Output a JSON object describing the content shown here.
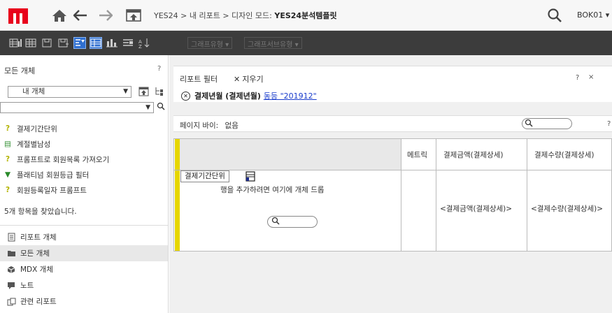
{
  "nav": {
    "breadcrumb_prefix": "YES24 > 내 리포트 > 디자인 모드:",
    "report_name": "YES24분석템플릿",
    "user": "BOK01 ▾"
  },
  "toolbar": {
    "graph_type": "그래프유형 ▾",
    "graph_subtype": "그래프서브유형 ▾"
  },
  "left_panel": {
    "title": "모든 개체",
    "help": "?",
    "object_select": "내 개체",
    "objects": [
      {
        "icon": "?",
        "label": "결제기간단위"
      },
      {
        "icon": "▤",
        "label": "계절별남성"
      },
      {
        "icon": "?",
        "label": "프롬프트로 회원목록 가져오기"
      },
      {
        "icon": "▼",
        "label": "플래티넘 회원등급 필터"
      },
      {
        "icon": "?",
        "label": "회원등록일자 프롬프트"
      }
    ],
    "found_text": "5개 항목을 찾았습니다.",
    "nav_items": [
      {
        "label": "리포트 개체",
        "selected": false
      },
      {
        "label": "모든 개체",
        "selected": true
      },
      {
        "label": "MDX 개체",
        "selected": false
      },
      {
        "label": "노트",
        "selected": false
      },
      {
        "label": "관련 리포트",
        "selected": false
      }
    ]
  },
  "filter": {
    "title": "리포트 필터",
    "clear": "지우기",
    "help": "?",
    "close": "×",
    "expr_attr": "결제년월 (결제년월)",
    "expr_link": "동등 \"201912\""
  },
  "page_by": {
    "label": "페이지 바이:",
    "value": "없음",
    "help": "?"
  },
  "grid": {
    "metrics_header": "메트릭",
    "columns": [
      "결제금액(결제상세)",
      "결제수량(결제상세)"
    ],
    "cells": [
      "<결제금액(결제상세)>",
      "<결제수량(결제상세)>"
    ],
    "row_attribute": "결제기간단위",
    "drop_hint": "행을 추가하려면 여기에 개체 드롭"
  },
  "colors": {
    "brand": "#e8001c",
    "toolbar_bg": "#3c3c3c",
    "drop_strip": "#e6d600",
    "link": "#1a3ccc"
  }
}
